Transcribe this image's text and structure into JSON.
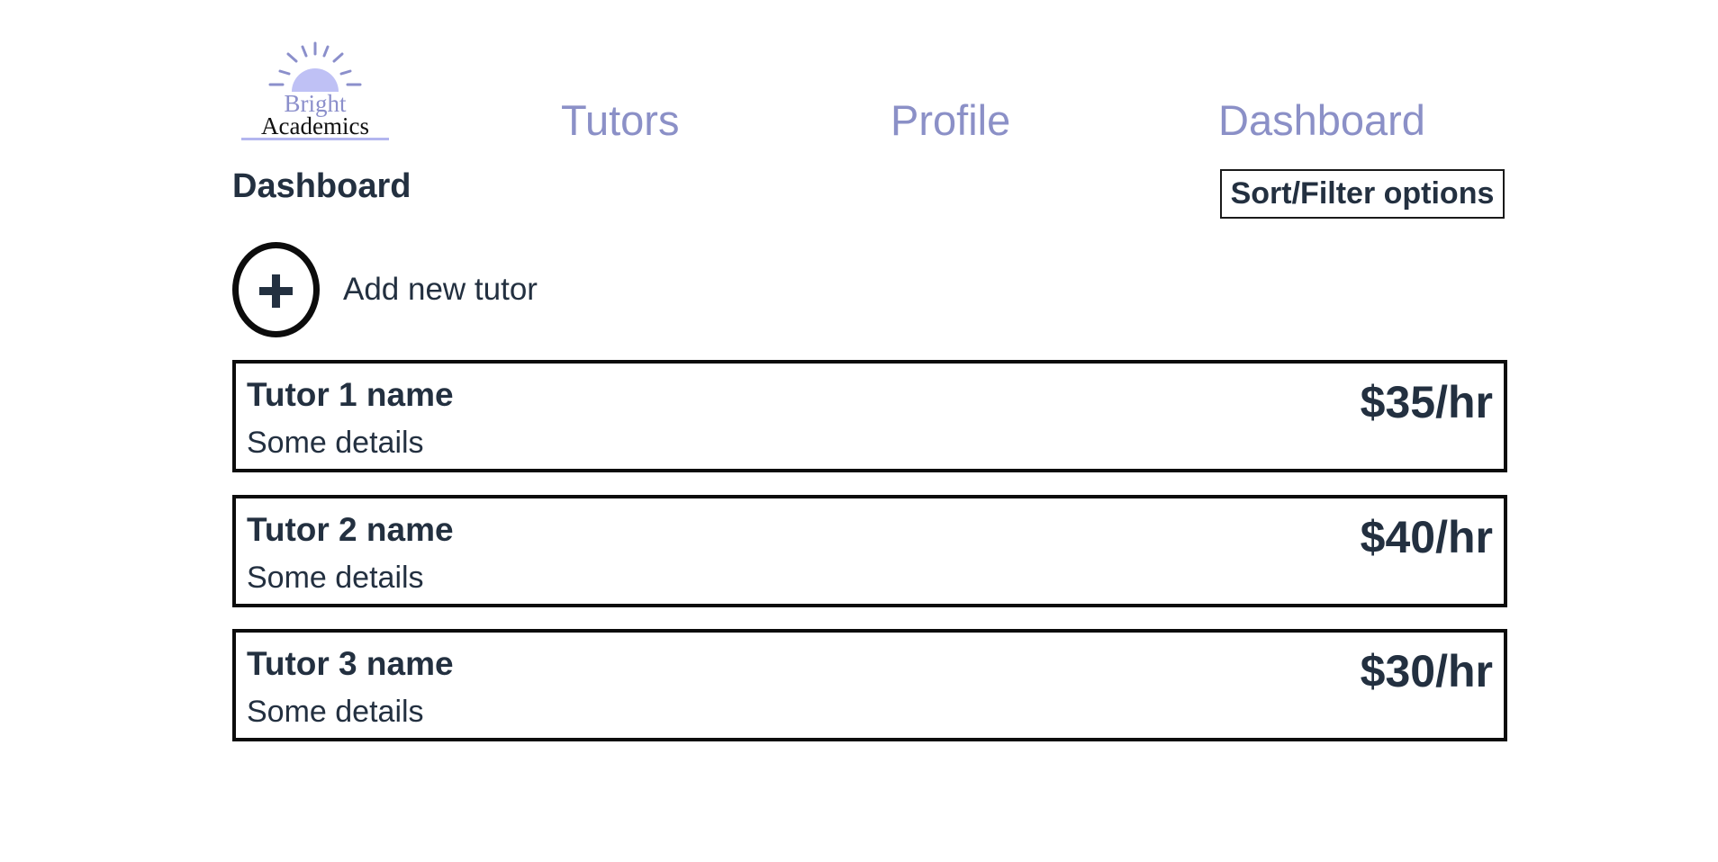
{
  "brand": {
    "line1": "Bright",
    "line2": "Academics",
    "sun_color": "#bfc1f5",
    "text_color": "#8b8fcb"
  },
  "nav": {
    "items": [
      {
        "label": "Tutors"
      },
      {
        "label": "Profile"
      },
      {
        "label": "Dashboard"
      }
    ],
    "link_color": "#8b90c7"
  },
  "main": {
    "title": "Dashboard",
    "sort_filter_label": "Sort/Filter options",
    "add_tutor_label": "Add new tutor",
    "add_icon": "plus-circle-icon"
  },
  "tutors": [
    {
      "name": "Tutor 1 name",
      "details": "Some details",
      "rate": "$35/hr"
    },
    {
      "name": "Tutor 2 name",
      "details": "Some details",
      "rate": "$40/hr"
    },
    {
      "name": "Tutor 3 name",
      "details": "Some details",
      "rate": "$30/hr"
    }
  ]
}
